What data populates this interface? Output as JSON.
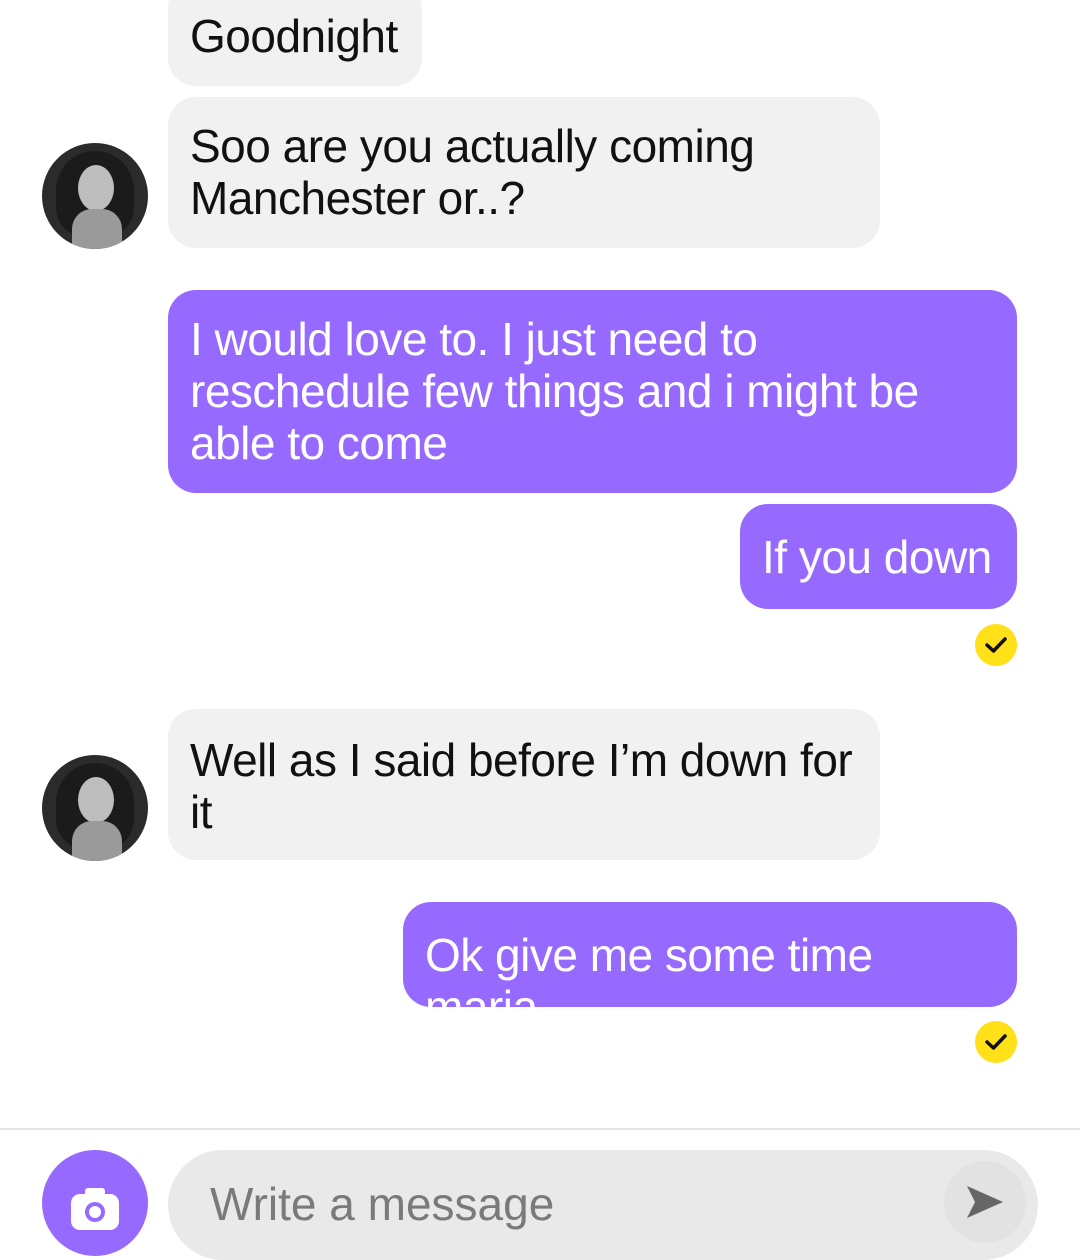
{
  "conversation": {
    "messages": [
      {
        "sender": "contact",
        "text": "Goodnight"
      },
      {
        "sender": "contact",
        "text": "Soo are you actually coming Manchester or..?"
      },
      {
        "sender": "me",
        "text": "I would love to. I just need to reschedule few things and i might be able to come"
      },
      {
        "sender": "me",
        "text": "If you down",
        "read": true
      },
      {
        "sender": "contact",
        "text": "Well as I said before I’m down for it"
      },
      {
        "sender": "me",
        "text": "Ok give me some time maria",
        "read": true
      }
    ]
  },
  "composer": {
    "placeholder": "Write a message",
    "camera_icon": "camera-icon",
    "send_icon": "send-arrow-icon"
  },
  "colors": {
    "outgoing_bubble": "#976aff",
    "incoming_bubble": "#f1f1f1",
    "read_receipt": "#ffe019",
    "camera_button": "#976aff"
  }
}
